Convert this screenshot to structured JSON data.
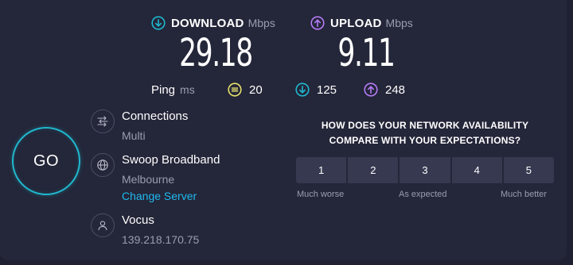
{
  "download": {
    "label": "DOWNLOAD",
    "unit": "Mbps",
    "value": "29.18"
  },
  "upload": {
    "label": "UPLOAD",
    "unit": "Mbps",
    "value": "9.11"
  },
  "ping": {
    "label": "Ping",
    "unit": "ms",
    "idle": "20",
    "download": "125",
    "upload": "248"
  },
  "go_label": "GO",
  "connections": {
    "title": "Connections",
    "value": "Multi"
  },
  "provider": {
    "name": "Swoop Broadband",
    "location": "Melbourne",
    "change_label": "Change Server"
  },
  "isp": {
    "name": "Vocus",
    "ip": "139.218.170.75"
  },
  "survey": {
    "question_line1": "HOW DOES YOUR NETWORK AVAILABILITY",
    "question_line2": "COMPARE WITH YOUR EXPECTATIONS?",
    "options": [
      "1",
      "2",
      "3",
      "4",
      "5"
    ],
    "caption_low": "Much worse",
    "caption_mid": "As expected",
    "caption_high": "Much better"
  },
  "colors": {
    "background": "#242639",
    "download_accent": "#1fb9cf",
    "upload_accent": "#b57cf6",
    "idle_accent": "#e8e36b",
    "link": "#1fb9ee"
  }
}
